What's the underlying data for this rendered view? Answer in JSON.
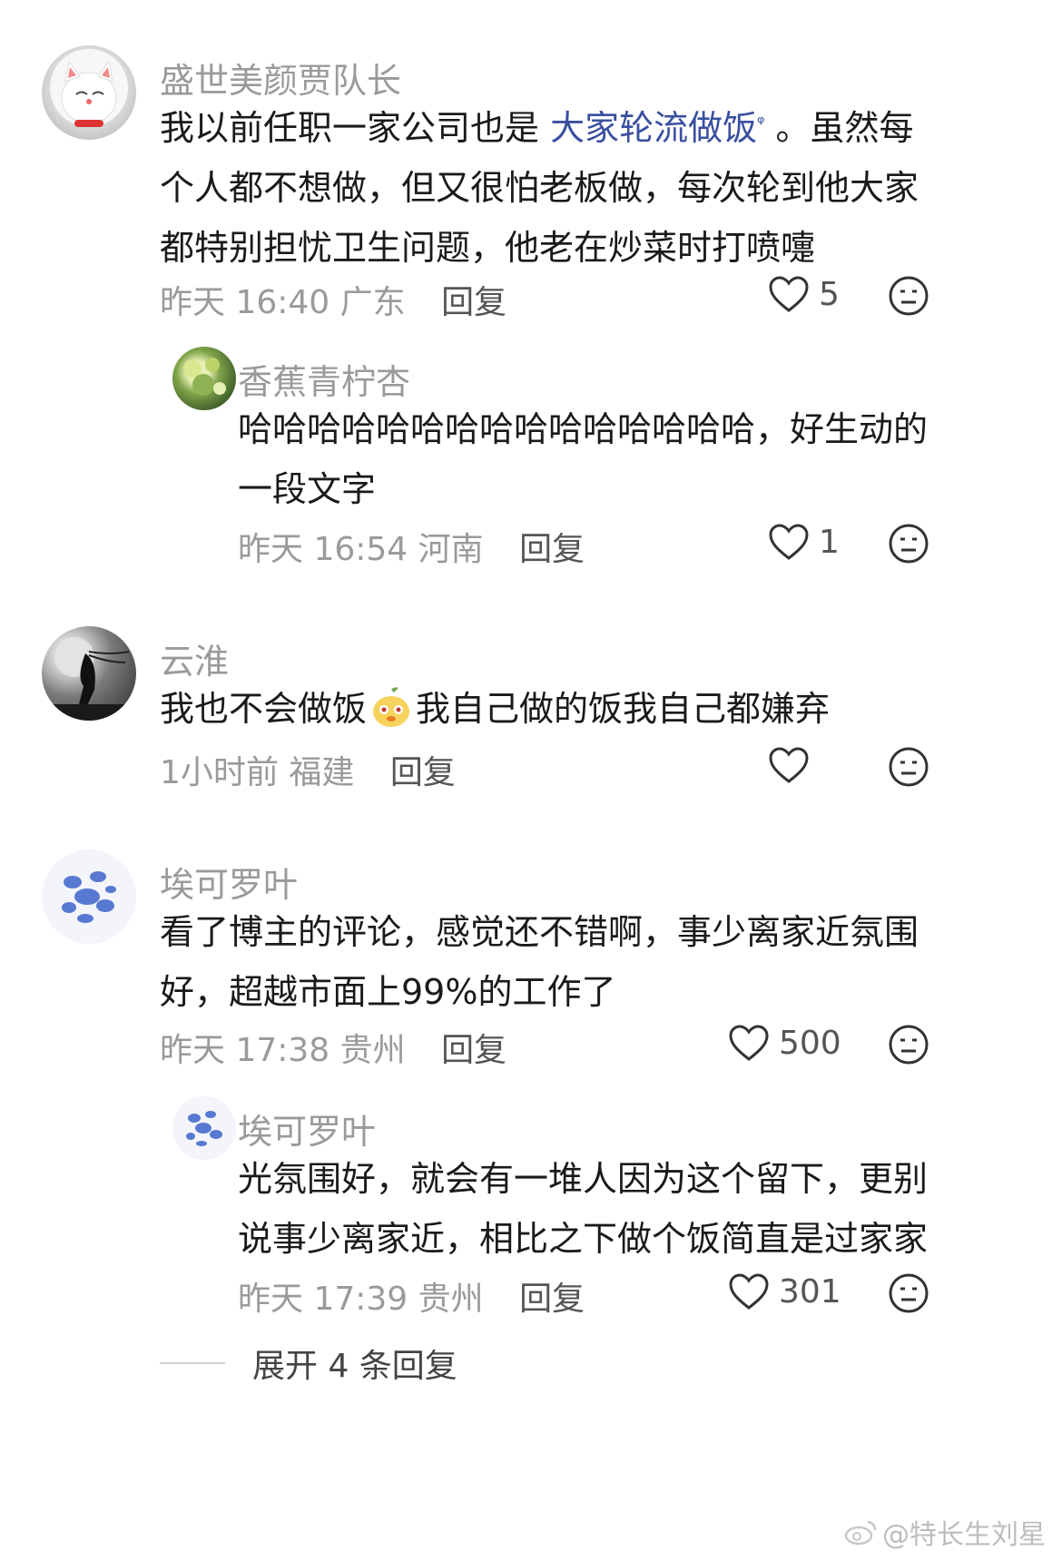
{
  "comments": [
    {
      "username": "盛世美颜贾队长",
      "text_before": "我以前任职一家公司也是 ",
      "link_text": "大家轮流做饭",
      "link_suffix_icon": "search-icon",
      "text_after": " 。虽然每个人都不想做，但又很怕老板做，每次轮到他大家都特别担忧卫生问题，他老在炒菜时打喷嚏",
      "time": "昨天 16:40",
      "location": "广东",
      "reply_label": "回复",
      "likes": "5",
      "avatar_icon": "lucky-cat-avatar"
    },
    {
      "username": "香蕉青柠杏",
      "text": "哈哈哈哈哈哈哈哈哈哈哈哈哈哈哈，好生动的一段文字",
      "time": "昨天 16:54",
      "location": "河南",
      "reply_label": "回复",
      "likes": "1",
      "avatar_icon": "green-plant-avatar"
    },
    {
      "username": "云淮",
      "text_before": "我也不会做饭",
      "emoji_icon": "pear-face-emoji",
      "text_after": "我自己做的饭我自己都嫌弃",
      "time": "1小时前",
      "location": "福建",
      "reply_label": "回复",
      "likes": "",
      "avatar_icon": "moon-figure-avatar"
    },
    {
      "username": "埃可罗叶",
      "text": "看了博主的评论，感觉还不错啊，事少离家近氛围好，超越市面上99%的工作了",
      "time": "昨天 17:38",
      "location": "贵州",
      "reply_label": "回复",
      "likes": "500",
      "avatar_icon": "blue-blotch-avatar"
    },
    {
      "username": "埃可罗叶",
      "text": "光氛围好，就会有一堆人因为这个留下，更别说事少离家近，相比之下做个饭简直是过家家",
      "time": "昨天 17:39",
      "location": "贵州",
      "reply_label": "回复",
      "likes": "301",
      "avatar_icon": "blue-blotch-avatar"
    }
  ],
  "expand_label": "展开 4 条回复",
  "watermark": "@特长生刘星",
  "colors": {
    "link": "#3a4fa0",
    "meta": "#9a9a9a",
    "text": "#1a1a1a"
  }
}
